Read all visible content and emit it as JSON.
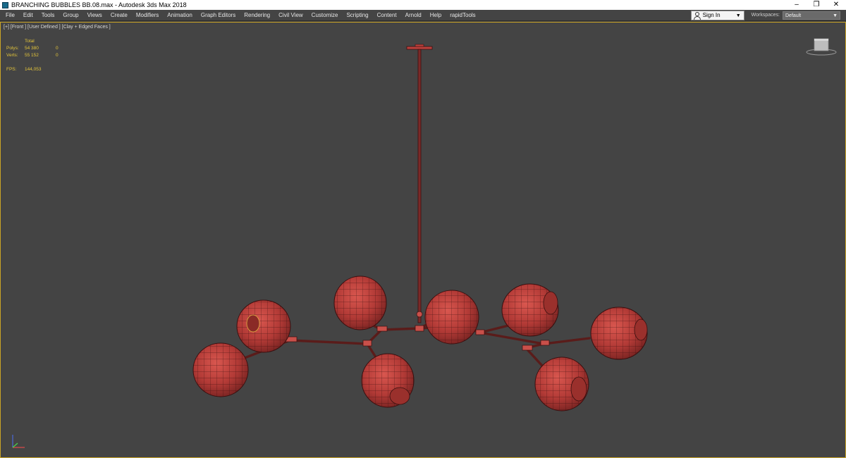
{
  "titlebar": {
    "title": "BRANCHING BUBBLES BB.08.max - Autodesk 3ds Max 2018",
    "minimize": "–",
    "restore": "❐",
    "close": "✕"
  },
  "menubar": {
    "items": [
      "File",
      "Edit",
      "Tools",
      "Group",
      "Views",
      "Create",
      "Modifiers",
      "Animation",
      "Graph Editors",
      "Rendering",
      "Civil View",
      "Customize",
      "Scripting",
      "Content",
      "Arnold",
      "Help",
      "rapidTools"
    ],
    "signin_label": "Sign In",
    "workspaces_label": "Workspaces:",
    "workspaces_value": "Default"
  },
  "viewport": {
    "label": "[+] [Front ] [User Defined ] [Clay + Edged Faces ]",
    "stats": {
      "header": "Total",
      "polys_label": "Polys:",
      "polys_value": "54 380",
      "polys_sel": "0",
      "verts_label": "Verts:",
      "verts_value": "55 152",
      "verts_sel": "0",
      "fps_label": "FPS:",
      "fps_value": "144,053"
    },
    "colors": {
      "border": "#c9a426",
      "stats_text": "#e3c43a",
      "clay": "#b9403c",
      "wire": "#3a0f0f"
    }
  }
}
